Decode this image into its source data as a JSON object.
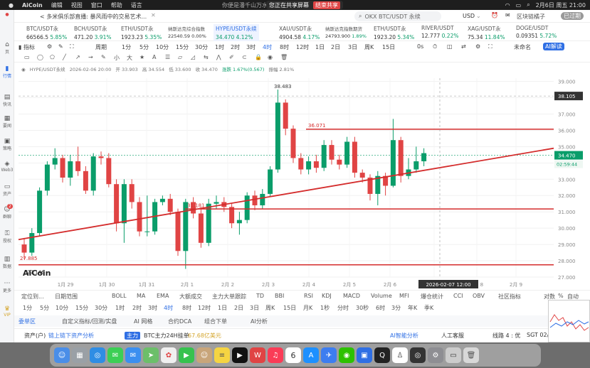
{
  "menubar": {
    "app": "AiCoin",
    "items": [
      "编辑",
      "视图",
      "窗口",
      "帮助",
      "语言"
    ],
    "user_text": "你便是潘千山万水",
    "share_text": "您正在共享屏幕",
    "share_stop": "结束共享",
    "datetime": "2月6日 周五 21:00"
  },
  "titlebar": {
    "breadcrumb": "< 多米俱乐部直播: 暴风雨中的交易艺术...",
    "search_placeholder": "OKX BTC/USDT 永续",
    "currency": "USD",
    "username": "区块链橘子",
    "status": "已过期"
  },
  "tickers": [
    {
      "name": "BTC/USDT永",
      "price": "66566.5",
      "change": "5.85%"
    },
    {
      "name": "BCH/USDT永",
      "price": "471.20",
      "change": "3.91%"
    },
    {
      "name": "ETH/USDT永",
      "price": "1923.23",
      "change": "5.35%"
    },
    {
      "name": "纳斯达克综合指数",
      "price": "22540.59",
      "change": "0.00%"
    },
    {
      "name": "HYPE/USDT永续",
      "price": "34.470",
      "change": "4.12%"
    },
    {
      "name": "XAU/USDT永",
      "price": "4904.58",
      "change": "4.17%"
    },
    {
      "name": "纳斯达克指数期货",
      "price": "24793.900",
      "change": "1.89%"
    },
    {
      "name": "ETH/USDT永",
      "price": "1923.20",
      "change": "5.34%"
    },
    {
      "name": "RIVER/USDT",
      "price": "12.777",
      "change": "0.22%"
    },
    {
      "name": "XAG/USDT永",
      "price": "75.34",
      "change": "11.84%"
    },
    {
      "name": "DOGE/USDT",
      "price": "0.09351",
      "change": "5.72%"
    }
  ],
  "toolbar": {
    "indicator": "指标",
    "period": "周期",
    "timeframes": [
      "1分",
      "5分",
      "10分",
      "15分",
      "30分",
      "1时",
      "2时",
      "3时",
      "4时",
      "8时",
      "12时",
      "1日",
      "2日",
      "3日",
      "周K",
      "15日"
    ],
    "selected": "4时",
    "countdown": "0s",
    "layout": "未命名",
    "ai": "AI解读"
  },
  "chart_info": {
    "symbol": "HYPE/USDT永续",
    "time": "2026-02-06 20:00",
    "open": "开 33.903",
    "high": "高 34.554",
    "low": "低 33.600",
    "close": "收 34.470",
    "change": "涨跌 1.67%(0.567)",
    "amplitude": "振幅 2.81%"
  },
  "chart_data": {
    "type": "candlestick",
    "ylim": [
      27.0,
      39.2
    ],
    "yticks": [
      "39.000",
      "38.000",
      "37.000",
      "36.000",
      "35.000",
      "34.000",
      "33.000",
      "32.000",
      "31.000",
      "30.000",
      "29.000",
      "28.000",
      "27.000"
    ],
    "xticks": [
      "1月 29",
      "1月 30",
      "1月 31",
      "2月 1",
      "2月 2",
      "2月 3",
      "2月 4",
      "2月 5",
      "2月 6",
      "2月 7",
      "2月 8",
      "2月 9"
    ],
    "current_price": "34.470",
    "countdown": "02:59:44",
    "crosshair_price": "38.105",
    "crosshair_time": "2026-02-07 12:00",
    "annotations": [
      "38.483",
      "36.071",
      "31.181",
      "27.885",
      "27.146"
    ],
    "hlines": [
      36.07,
      31.18,
      27.75
    ],
    "trendline": {
      "from": [
        0,
        29.3
      ],
      "to": [
        54,
        34.9
      ]
    },
    "candles": [
      [
        29.0,
        28.5,
        29.4,
        28.1
      ],
      [
        28.5,
        29.7,
        30.0,
        28.3
      ],
      [
        29.7,
        32.3,
        32.5,
        29.5
      ],
      [
        32.3,
        33.9,
        34.1,
        32.0
      ],
      [
        33.9,
        34.3,
        34.9,
        33.6
      ],
      [
        34.3,
        33.1,
        34.5,
        32.8
      ],
      [
        33.1,
        34.1,
        34.5,
        32.6
      ],
      [
        34.1,
        33.5,
        35.0,
        33.2
      ],
      [
        33.5,
        32.3,
        33.8,
        32.1
      ],
      [
        32.3,
        34.4,
        34.6,
        32.0
      ],
      [
        34.4,
        34.3,
        34.7,
        33.9
      ],
      [
        34.3,
        32.7,
        34.6,
        32.5
      ],
      [
        32.7,
        30.3,
        33.0,
        29.8
      ],
      [
        30.3,
        32.7,
        33.0,
        29.1
      ],
      [
        32.7,
        31.6,
        33.0,
        31.2
      ],
      [
        31.6,
        29.8,
        31.9,
        29.5
      ],
      [
        29.8,
        29.8,
        32.0,
        29.5
      ],
      [
        29.8,
        31.6,
        31.8,
        29.6
      ],
      [
        31.6,
        31.8,
        32.0,
        31.4
      ],
      [
        31.8,
        31.0,
        32.1,
        30.8
      ],
      [
        31.0,
        28.6,
        31.2,
        28.3
      ],
      [
        28.6,
        31.6,
        31.8,
        27.5
      ],
      [
        31.6,
        30.9,
        31.9,
        30.6
      ],
      [
        30.9,
        29.1,
        31.3,
        28.8
      ],
      [
        29.1,
        31.5,
        31.8,
        28.9
      ],
      [
        31.5,
        31.6,
        32.0,
        31.2
      ],
      [
        31.6,
        31.3,
        31.9,
        31.0
      ],
      [
        31.3,
        30.3,
        31.5,
        30.0
      ],
      [
        30.3,
        30.5,
        31.0,
        29.6
      ],
      [
        30.5,
        32.0,
        32.2,
        30.3
      ],
      [
        32.0,
        31.4,
        32.3,
        31.1
      ],
      [
        31.4,
        32.1,
        32.4,
        31.2
      ],
      [
        32.1,
        33.6,
        33.8,
        31.9
      ],
      [
        33.6,
        37.7,
        38.5,
        33.4
      ],
      [
        37.7,
        36.1,
        37.9,
        35.7
      ],
      [
        36.1,
        34.3,
        36.3,
        34.0
      ],
      [
        34.3,
        33.6,
        34.6,
        33.3
      ],
      [
        33.6,
        34.1,
        34.4,
        33.3
      ],
      [
        34.1,
        33.7,
        34.5,
        33.4
      ],
      [
        33.7,
        35.1,
        35.4,
        33.5
      ],
      [
        35.1,
        34.2,
        35.4,
        33.9
      ],
      [
        34.2,
        33.9,
        34.5,
        33.6
      ],
      [
        33.9,
        35.3,
        35.6,
        33.7
      ],
      [
        35.3,
        33.4,
        35.6,
        33.1
      ],
      [
        33.4,
        33.1,
        33.6,
        32.8
      ],
      [
        33.1,
        32.1,
        33.3,
        31.7
      ],
      [
        32.1,
        33.2,
        33.5,
        31.4
      ],
      [
        33.2,
        32.6,
        33.4,
        32.0
      ],
      [
        32.6,
        35.4,
        36.7,
        32.5
      ],
      [
        35.4,
        33.2,
        35.6,
        32.8
      ],
      [
        33.2,
        33.6,
        34.3,
        33.0
      ],
      [
        33.6,
        34.1,
        35.0,
        33.4
      ],
      [
        34.1,
        34.6,
        34.9,
        33.8
      ]
    ]
  },
  "indicator_bar": {
    "items": [
      "定位到...",
      "日期范围",
      "BOLL",
      "MA",
      "EMA",
      "大额成交",
      "主力大单跟踪",
      "TD",
      "BBI",
      "RSI",
      "KDJ",
      "MACD",
      "Volume",
      "MFI",
      "爆仓统计",
      "CCI",
      "OBV",
      "社区指标",
      "对数",
      "%",
      "自动"
    ]
  },
  "period_bar": {
    "items": [
      "1分",
      "5分",
      "10分",
      "15分",
      "30分",
      "1时",
      "2时",
      "3时",
      "4时",
      "8时",
      "12时",
      "1日",
      "2日",
      "3日",
      "周K",
      "15日",
      "月K",
      "1秒",
      "分时",
      "30秒",
      "6时",
      "3分",
      "年K",
      "季K"
    ],
    "selected": "4时"
  },
  "tabs_bar": {
    "items": [
      "委单区",
      "自定义指标/回测/实盘",
      "AI 网格",
      "合约DCA",
      "组合下单",
      "AI分析"
    ],
    "selected": "委单区"
  },
  "status_bar": {
    "assets": "资产(户)",
    "chain_analysis": "链上链下资产分析",
    "main_force": "主力",
    "main_force_text": "BTC主力24H挂单",
    "main_force_value": "67.68亿美元",
    "ai_smart": "AI智能分析",
    "service": "人工客服",
    "line_status": "线路 4 : 优",
    "sgt": "SGT 02/0"
  },
  "dock": {
    "calendar_day": "6"
  },
  "colors": {
    "up": "#0a9d6a",
    "down": "#e04444",
    "accent": "#2f6fe4",
    "line": "#d42c2c"
  }
}
